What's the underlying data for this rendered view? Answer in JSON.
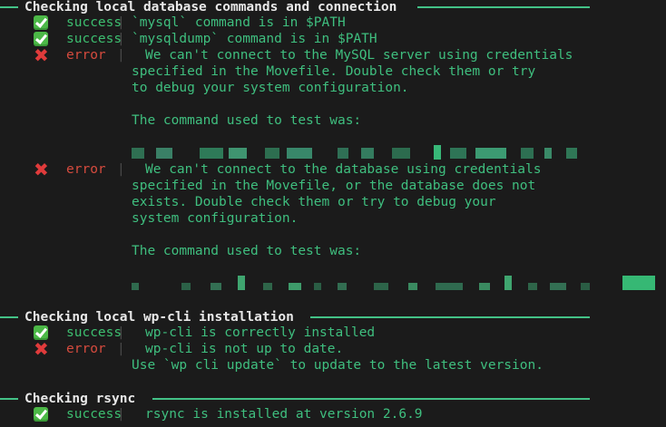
{
  "colors": {
    "background": "#1b1b1b",
    "heading": "#e8e8e8",
    "rule": "#43c287",
    "text": "#3fbf7f",
    "success": "#3dbf70",
    "error": "#d64b3e",
    "separator": "#4a4a4a"
  },
  "sections": [
    {
      "title": "Checking local database commands and connection",
      "entries": [
        {
          "icon": "check-mark-icon",
          "status": "success",
          "lines": [
            "`mysql` command is in $PATH"
          ]
        },
        {
          "icon": "check-mark-icon",
          "status": "success",
          "lines": [
            "`mysqldump` command is in $PATH"
          ]
        },
        {
          "icon": "cross-mark-icon",
          "status": "error",
          "lines": [
            "We can't connect to the MySQL server using credentials",
            "specified in the Movefile. Double check them or try",
            "to debug your system configuration.",
            "",
            "The command used to test was:",
            "",
            "[redacted command]"
          ]
        },
        {
          "icon": "cross-mark-icon",
          "status": "error",
          "lines": [
            "We can't connect to the database using credentials",
            "specified in the Movefile, or the database does not",
            "exists. Double check them or try to debug your",
            "system configuration.",
            "",
            "The command used to test was:",
            "",
            "[redacted command]"
          ]
        }
      ]
    },
    {
      "title": "Checking local wp-cli installation",
      "entries": [
        {
          "icon": "check-mark-icon",
          "status": "success",
          "lines": [
            "wp-cli is correctly installed"
          ]
        },
        {
          "icon": "cross-mark-icon",
          "status": "error",
          "lines": [
            "wp-cli is not up to date.",
            "Use `wp cli update` to update to the latest version."
          ]
        }
      ]
    },
    {
      "title": "Checking rsync",
      "entries": [
        {
          "icon": "check-mark-icon",
          "status": "success",
          "lines": [
            "rsync is installed at version 2.6.9"
          ]
        }
      ]
    }
  ]
}
